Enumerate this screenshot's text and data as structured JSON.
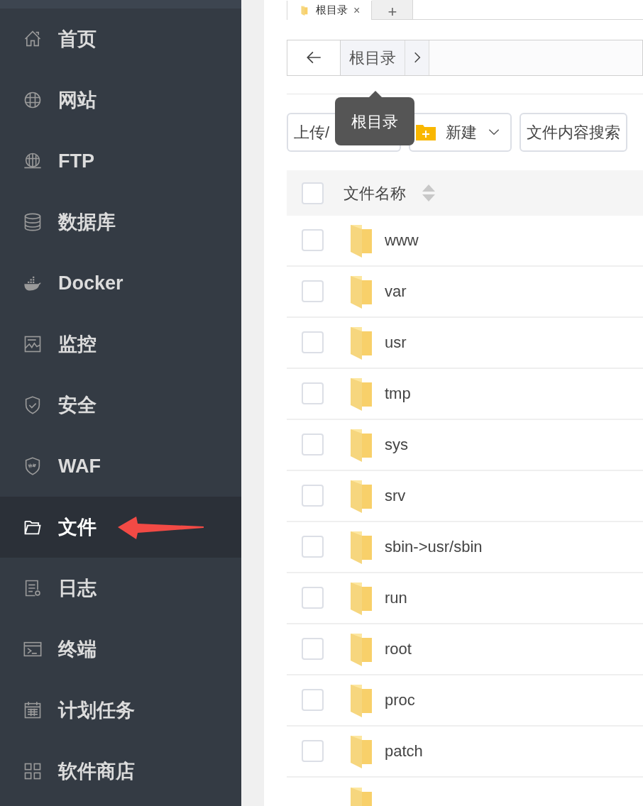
{
  "sidebar": {
    "items": [
      {
        "label": "首页",
        "selected": false
      },
      {
        "label": "网站",
        "selected": false
      },
      {
        "label": "FTP",
        "selected": false
      },
      {
        "label": "数据库",
        "selected": false
      },
      {
        "label": "Docker",
        "selected": false
      },
      {
        "label": "监控",
        "selected": false
      },
      {
        "label": "安全",
        "selected": false
      },
      {
        "label": "WAF",
        "selected": false
      },
      {
        "label": "文件",
        "selected": true
      },
      {
        "label": "日志",
        "selected": false
      },
      {
        "label": "终端",
        "selected": false
      },
      {
        "label": "计划任务",
        "selected": false
      },
      {
        "label": "软件商店",
        "selected": false
      }
    ]
  },
  "tabs": [
    {
      "label": "根目录",
      "close": "×",
      "selected": true
    }
  ],
  "add_tab": "+",
  "breadcrumb": {
    "items": [
      "根目录"
    ]
  },
  "tooltip": "根目录",
  "toolbar": [
    {
      "kind": "plain",
      "label": "上传/"
    },
    {
      "kind": "new",
      "label": "新建"
    },
    {
      "kind": "plain",
      "label": "文件内容搜索"
    }
  ],
  "table": {
    "header": {
      "label": "文件名称",
      "checked": false
    },
    "rows": [
      {
        "name": "www",
        "checked": false
      },
      {
        "name": "var",
        "checked": false
      },
      {
        "name": "usr",
        "checked": false
      },
      {
        "name": "tmp",
        "checked": false
      },
      {
        "name": "sys",
        "checked": false
      },
      {
        "name": "srv",
        "checked": false
      },
      {
        "name": "sbin->usr/sbin",
        "checked": false
      },
      {
        "name": "run",
        "checked": false
      },
      {
        "name": "root",
        "checked": false
      },
      {
        "name": "proc",
        "checked": false
      },
      {
        "name": "patch",
        "checked": false
      }
    ]
  }
}
